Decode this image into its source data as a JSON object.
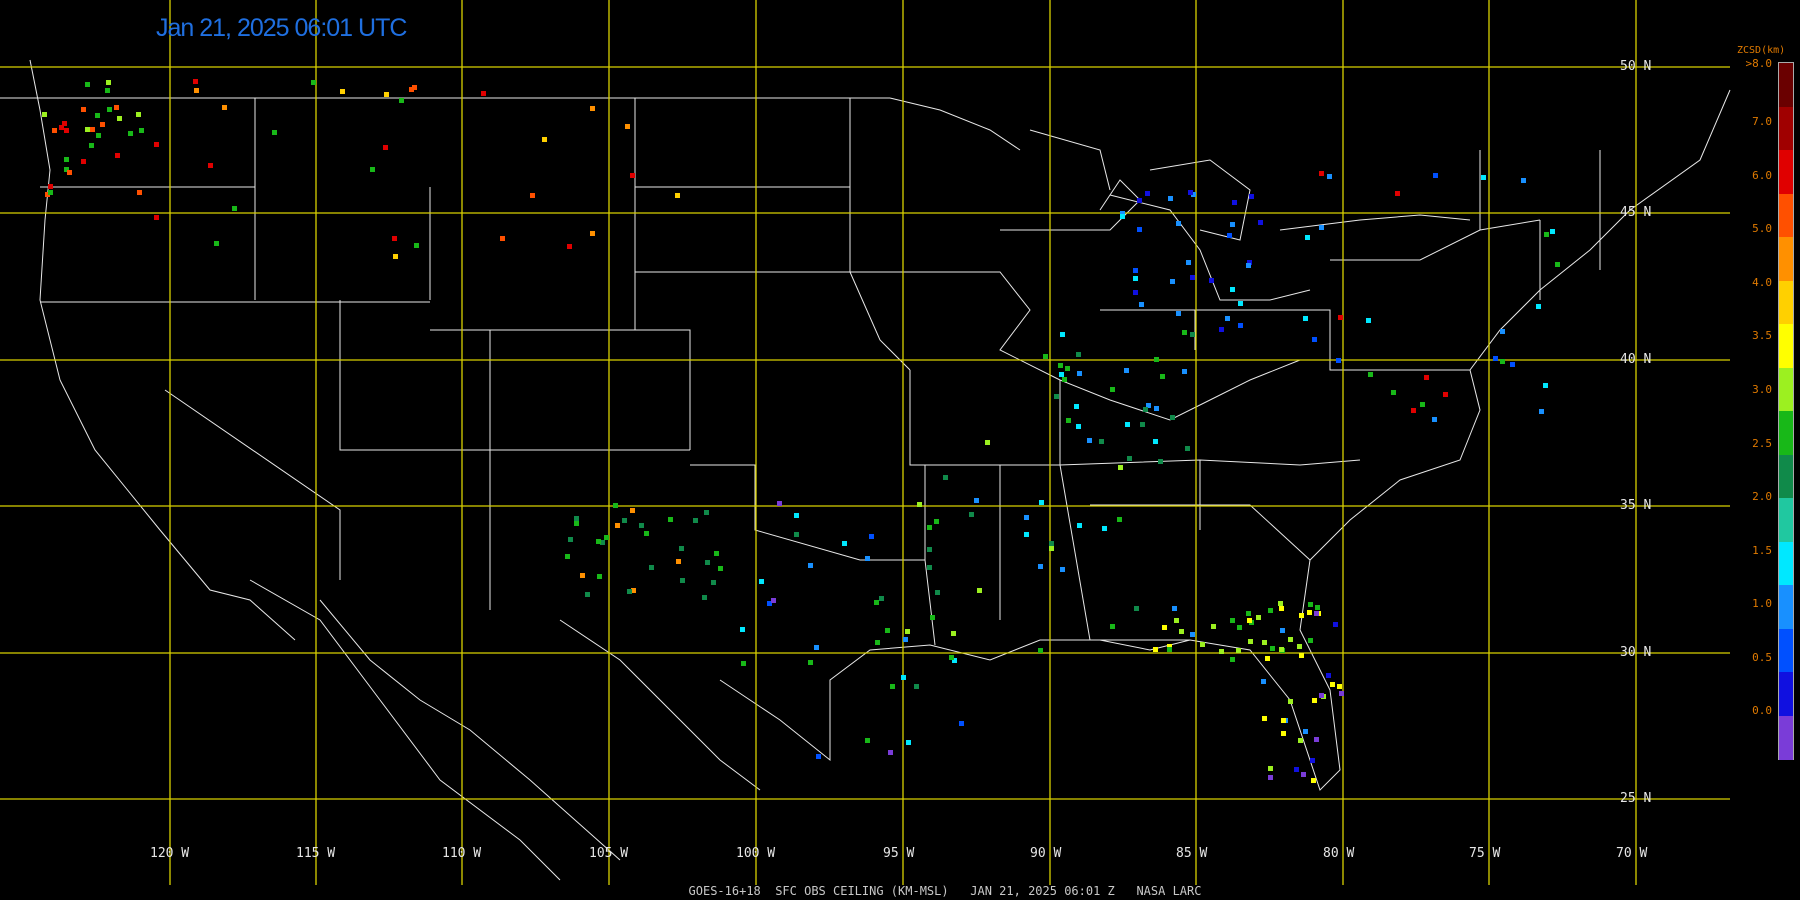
{
  "title": "Jan 21, 2025 06:01 UTC",
  "footer": "GOES-16+18  SFC OBS CEILING (KM-MSL)   JAN 21, 2025 06:01 Z   NASA LARC",
  "lat_labels": [
    "50 N",
    "45 N",
    "40 N",
    "35 N",
    "30 N",
    "25 N"
  ],
  "lon_labels": [
    "120 W",
    "115 W",
    "110 W",
    "105 W",
    "100 W",
    "95 W",
    "90 W",
    "85 W",
    "80 W",
    "75 W",
    "70 W"
  ],
  "colors": {
    "grid": "#d8d000",
    "border": "#e8e8e8",
    "title": "#1f6fe0",
    "scale_text": "#e07a00"
  },
  "legend": {
    "title": "ZCSD(km)",
    "labels": [
      ">8.0",
      "7.0",
      "6.0",
      "5.0",
      "4.0",
      "3.5",
      "3.0",
      "2.5",
      "2.0",
      "1.5",
      "1.0",
      "0.5",
      "0.0"
    ],
    "colors": [
      "#6a0000",
      "#a00000",
      "#e00000",
      "#ff5000",
      "#ff9000",
      "#ffd000",
      "#ffff00",
      "#9cf020",
      "#18b818",
      "#108a4a",
      "#20c8a0",
      "#00e8ff",
      "#1890ff",
      "#0050ff",
      "#1010e0",
      "#7a3cd8"
    ]
  }
}
